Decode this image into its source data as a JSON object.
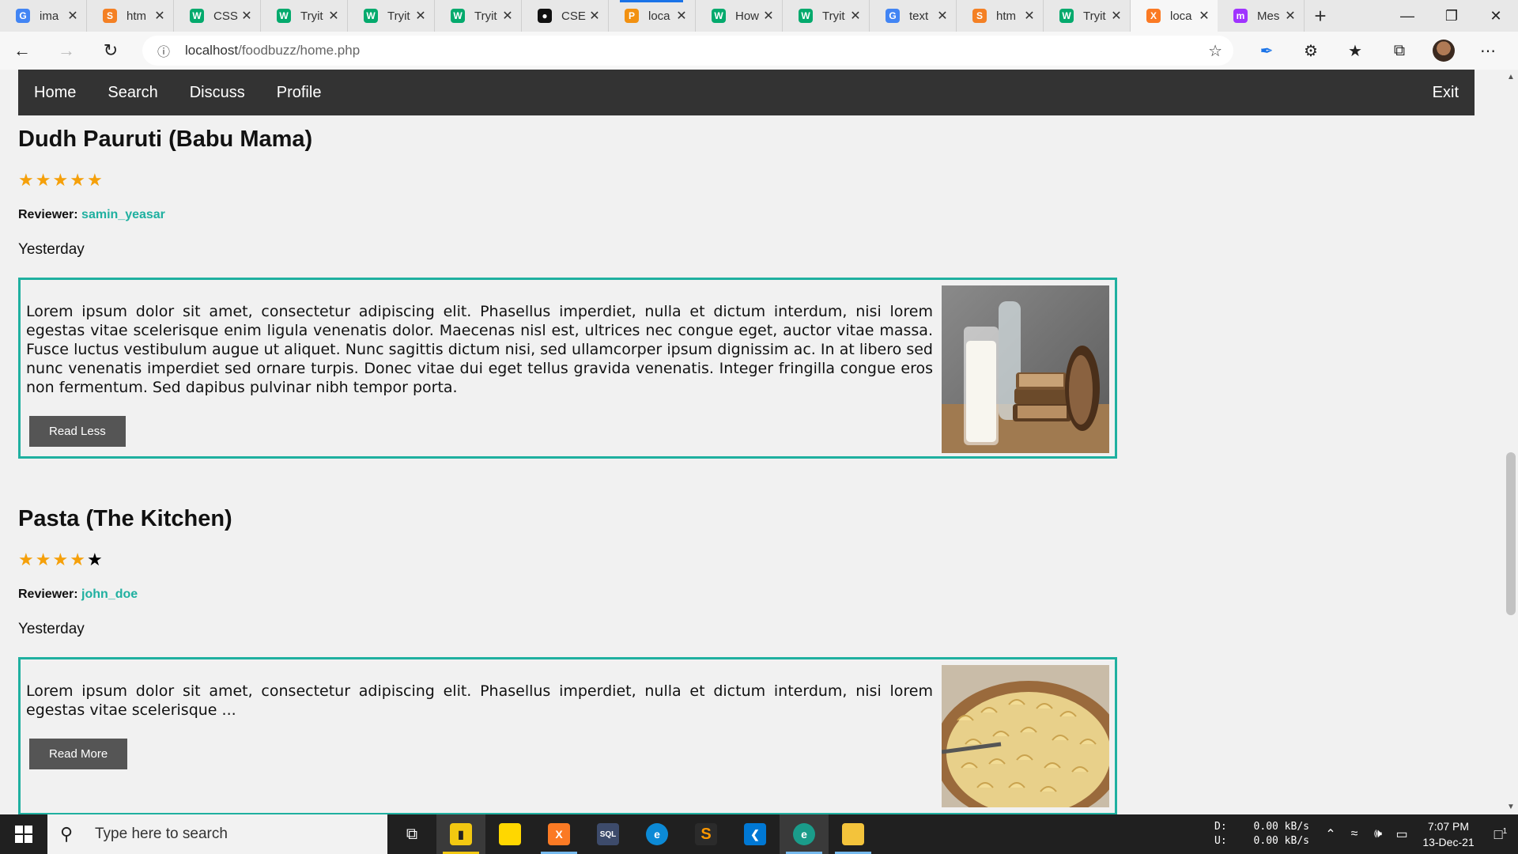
{
  "browser": {
    "tabs": [
      {
        "label": "ima",
        "icon": "google-icon",
        "color": "#4285f4",
        "glyph": "G"
      },
      {
        "label": "htm",
        "icon": "stackoverflow-icon",
        "color": "#f48024",
        "glyph": "S"
      },
      {
        "label": "CSS",
        "icon": "w3schools-icon",
        "color": "#04aa6d",
        "glyph": "W"
      },
      {
        "label": "Tryit",
        "icon": "w3schools-icon",
        "color": "#04aa6d",
        "glyph": "W"
      },
      {
        "label": "Tryit",
        "icon": "w3schools-icon",
        "color": "#04aa6d",
        "glyph": "W"
      },
      {
        "label": "Tryit",
        "icon": "w3schools-icon",
        "color": "#04aa6d",
        "glyph": "W"
      },
      {
        "label": "CSE",
        "icon": "github-icon",
        "color": "#111111",
        "glyph": "●"
      },
      {
        "label": "loca",
        "icon": "phpmyadmin-icon",
        "color": "#f29111",
        "glyph": "P"
      },
      {
        "label": "How",
        "icon": "w3schools-icon",
        "color": "#04aa6d",
        "glyph": "W"
      },
      {
        "label": "Tryit",
        "icon": "w3schools-icon",
        "color": "#04aa6d",
        "glyph": "W"
      },
      {
        "label": "text",
        "icon": "google-icon",
        "color": "#4285f4",
        "glyph": "G"
      },
      {
        "label": "htm",
        "icon": "stackoverflow-icon",
        "color": "#f48024",
        "glyph": "S"
      },
      {
        "label": "Tryit",
        "icon": "w3schools-icon",
        "color": "#04aa6d",
        "glyph": "W"
      },
      {
        "label": "loca",
        "icon": "xampp-icon",
        "color": "#fb7a24",
        "glyph": "X",
        "active": true
      },
      {
        "label": "Mes",
        "icon": "messenger-icon",
        "color": "#a033ff",
        "glyph": "m"
      }
    ],
    "address": {
      "host": "localhost",
      "path": "/foodbuzz/home.php"
    }
  },
  "nav": {
    "home": "Home",
    "search": "Search",
    "discuss": "Discuss",
    "profile": "Profile",
    "exit": "Exit"
  },
  "reviews": [
    {
      "title": "Dudh Pauruti (Babu Mama)",
      "rating": 5,
      "reviewer_label": "Reviewer:",
      "reviewer": "samin_yeasar",
      "date": "Yesterday",
      "text": "Lorem ipsum dolor sit amet, consectetur adipiscing elit. Phasellus imperdiet, nulla et dictum interdum, nisi lorem egestas vitae scelerisque enim ligula venenatis dolor. Maecenas nisl est, ultrices nec congue eget, auctor vitae massa. Fusce luctus vestibulum augue ut aliquet. Nunc sagittis dictum nisi, sed ullamcorper ipsum dignissim ac. In at libero sed nunc venenatis imperdiet sed ornare turpis. Donec vitae dui eget tellus gravida venenatis. Integer fringilla congue eros non fermentum. Sed dapibus pulvinar nibh tempor porta.",
      "button": "Read Less",
      "image": "milk-and-bread-photo"
    },
    {
      "title": "Pasta (The Kitchen)",
      "rating": 4,
      "reviewer_label": "Reviewer:",
      "reviewer": "john_doe",
      "date": "Yesterday",
      "text": "Lorem ipsum dolor sit amet, consectetur adipiscing elit. Phasellus imperdiet, nulla et dictum interdum, nisi lorem egestas vitae scelerisque ...",
      "button": "Read More",
      "image": "pasta-photo"
    }
  ],
  "taskbar": {
    "search_placeholder": "Type here to search",
    "net_down_label": "D:",
    "net_up_label": "U:",
    "net_down": "0.00 kB/s",
    "net_up": "0.00 kB/s",
    "time": "7:07 PM",
    "date": "13-Dec-21",
    "notifications": "1"
  },
  "colors": {
    "accent": "#1fb0a0",
    "star": "#f5a00a",
    "navbar": "#333333",
    "button": "#555555"
  }
}
